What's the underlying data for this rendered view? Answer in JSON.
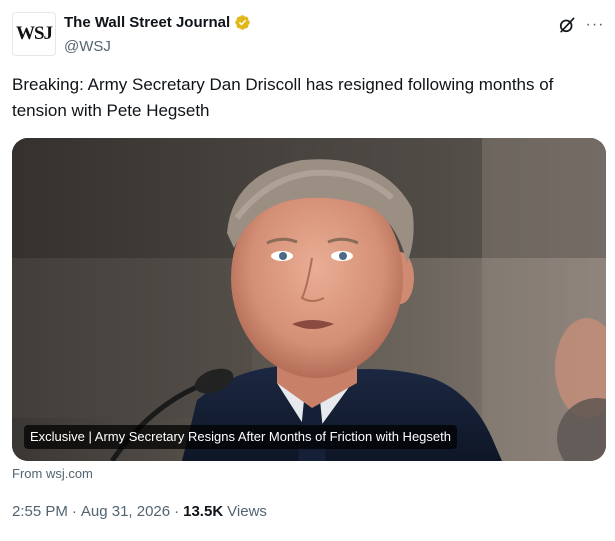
{
  "author": {
    "avatar_text": "WSJ",
    "display_name": "The Wall Street Journal",
    "handle": "@WSJ",
    "verified_color": "#e2b719"
  },
  "actions": {
    "grok_icon": "grok-icon",
    "more_label": "···"
  },
  "tweet": {
    "text": "Breaking: Army Secretary Dan Driscoll has resigned following months of tension with Pete Hegseth"
  },
  "media": {
    "caption": "Exclusive | Army Secretary Resigns After Months of Friction with Hegseth",
    "source": "From wsj.com"
  },
  "meta": {
    "time": "2:55 PM",
    "separator": "·",
    "date": "Aug 31, 2026",
    "views_count": "13.5K",
    "views_label": "Views"
  },
  "colors": {
    "text_primary": "#0f1419",
    "text_secondary": "#536471",
    "verified_gold": "#e2b719"
  }
}
